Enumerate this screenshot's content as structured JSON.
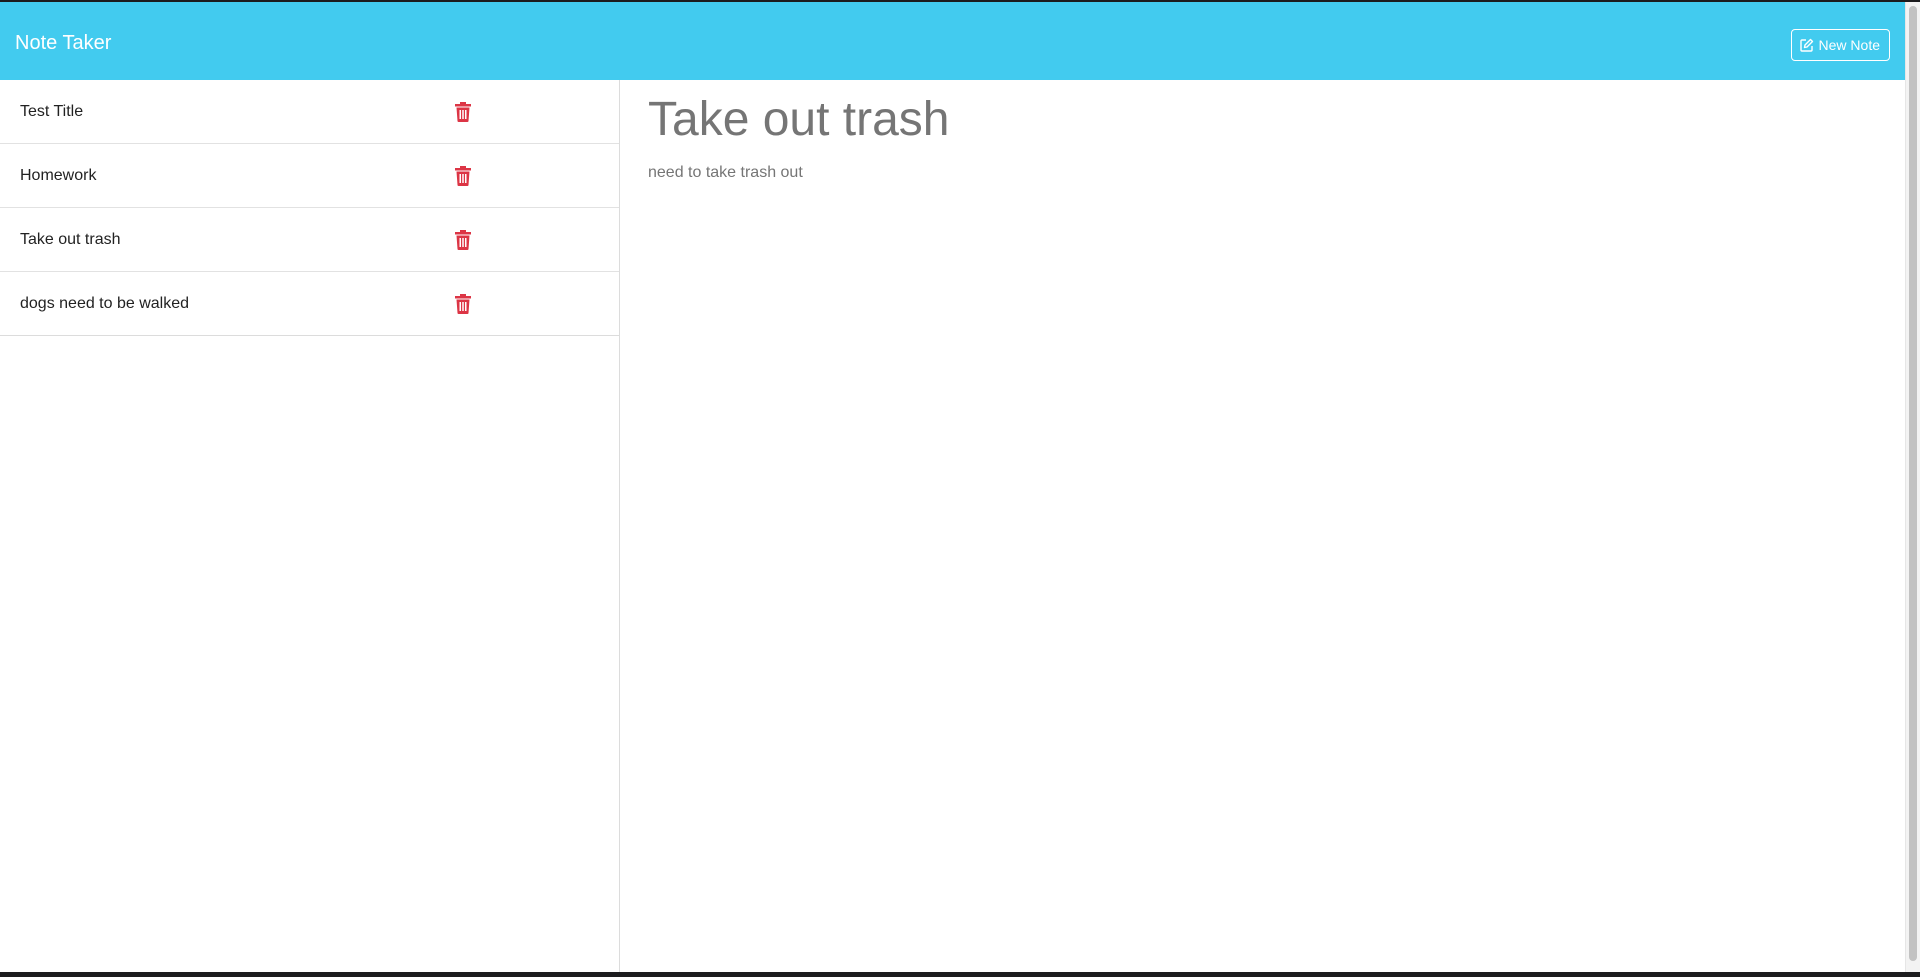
{
  "navbar": {
    "brand": "Note Taker",
    "new_note_label": "New Note",
    "new_note_icon": "edit-icon",
    "background_color": "#42cbef"
  },
  "notes": [
    {
      "title": "Test Title",
      "delete_icon": "trash-icon"
    },
    {
      "title": "Homework",
      "delete_icon": "trash-icon"
    },
    {
      "title": "Take out trash",
      "delete_icon": "trash-icon"
    },
    {
      "title": "dogs need to be walked",
      "delete_icon": "trash-icon"
    }
  ],
  "active_note": {
    "title": "Take out trash",
    "text": "need to take trash out"
  },
  "colors": {
    "delete": "#dc3545",
    "editor_text": "#757575"
  }
}
